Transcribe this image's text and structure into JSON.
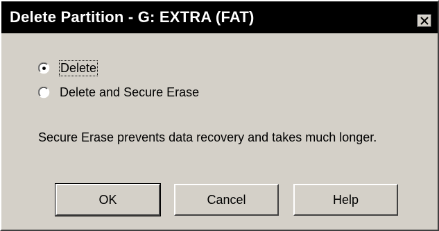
{
  "window": {
    "title": "Delete Partition - G: EXTRA (FAT)",
    "close_icon": "close-x-icon"
  },
  "options": {
    "selected": "delete",
    "items": [
      {
        "id": "delete",
        "label": "Delete"
      },
      {
        "id": "delete_secure",
        "label": "Delete and Secure Erase"
      }
    ]
  },
  "description": "Secure Erase prevents data recovery and takes much longer.",
  "buttons": {
    "ok": "OK",
    "cancel": "Cancel",
    "help": "Help"
  }
}
